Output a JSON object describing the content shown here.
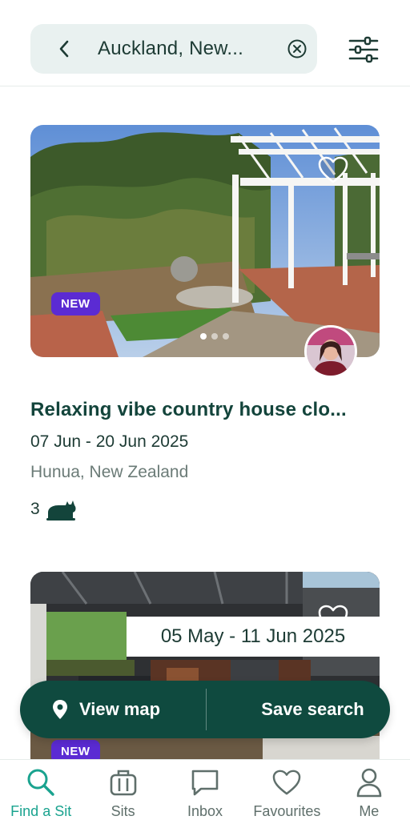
{
  "header": {
    "search_value": "Auckland, New...",
    "back_icon": "chevron-left-icon",
    "clear_icon": "clear-circle-icon",
    "filter_icon": "sliders-icon"
  },
  "listings": [
    {
      "badge": "NEW",
      "title": "Relaxing vibe country house clo...",
      "dates": "07 Jun - 20 Jun 2025",
      "location": "Hunua, New Zealand",
      "pet_count": "3",
      "pet_icon": "cat-icon",
      "photo_index": 1,
      "photo_total": 3
    },
    {
      "badge": "NEW",
      "dates": "05 May - 11 Jun 2025"
    }
  ],
  "action_bar": {
    "view_map": "View map",
    "save_search": "Save search"
  },
  "nav": {
    "items": [
      {
        "label": "Find a Sit",
        "icon": "search-icon",
        "active": true
      },
      {
        "label": "Sits",
        "icon": "suitcase-icon",
        "active": false
      },
      {
        "label": "Inbox",
        "icon": "chat-icon",
        "active": false
      },
      {
        "label": "Favourites",
        "icon": "heart-icon",
        "active": false
      },
      {
        "label": "Me",
        "icon": "person-icon",
        "active": false
      }
    ]
  },
  "colors": {
    "brand_dark": "#0f4a3f",
    "accent_teal": "#1aa38f",
    "badge_purple": "#5b2bd3",
    "search_bg": "#e9f1f0"
  }
}
